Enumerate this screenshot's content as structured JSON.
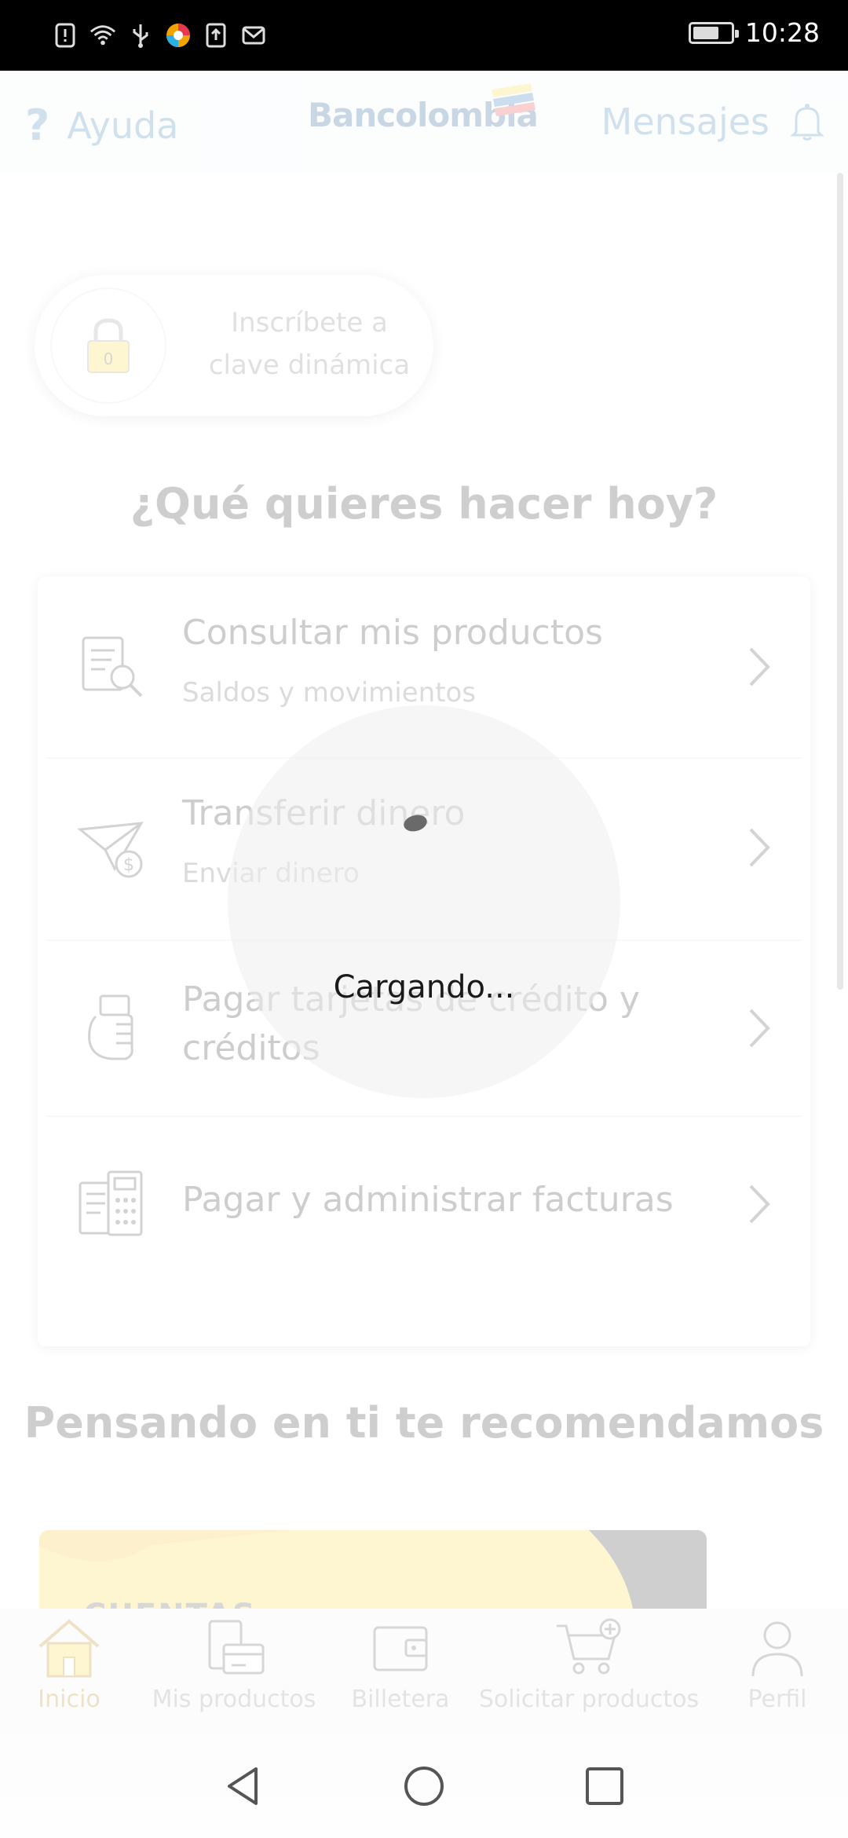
{
  "status_bar": {
    "time": "10:28",
    "icons": [
      "alert-icon",
      "wifi-icon",
      "usb-icon",
      "app-icon",
      "upload-icon",
      "mail-icon"
    ],
    "battery": "charging"
  },
  "header": {
    "help_label": "Ayuda",
    "logo_text": "Bancolombia",
    "messages_label": "Mensajes"
  },
  "dynamic_key": {
    "text": "Inscríbete a clave dinámica"
  },
  "main": {
    "question": "¿Qué quieres hacer hoy?",
    "menu": [
      {
        "title": "Consultar mis productos",
        "subtitle": "Saldos y movimientos",
        "icon": "document-search-icon"
      },
      {
        "title": "Transferir dinero",
        "subtitle": "Enviar dinero",
        "icon": "paper-plane-money-icon"
      },
      {
        "title": "Pagar tarjetas de crédito y créditos",
        "subtitle": "",
        "icon": "hand-card-icon"
      },
      {
        "title": "Pagar y administrar facturas",
        "subtitle": "",
        "icon": "invoice-calculator-icon"
      }
    ],
    "recommend_title": "Pensando en ti te recomendamos",
    "promo_text": "CUENTAS"
  },
  "bottom_nav": [
    {
      "label": "Inicio",
      "icon": "home-icon",
      "active": true
    },
    {
      "label": "Mis productos",
      "icon": "products-icon",
      "active": false
    },
    {
      "label": "Billetera",
      "icon": "wallet-icon",
      "active": false
    },
    {
      "label": "Solicitar productos",
      "icon": "cart-plus-icon",
      "active": false
    },
    {
      "label": "Perfil",
      "icon": "profile-icon",
      "active": false
    }
  ],
  "loading": {
    "text": "Cargando..."
  },
  "colors": {
    "brand_blue": "#1b4f8a",
    "brand_yellow": "#fdd835",
    "link_blue": "#3a78b5"
  }
}
